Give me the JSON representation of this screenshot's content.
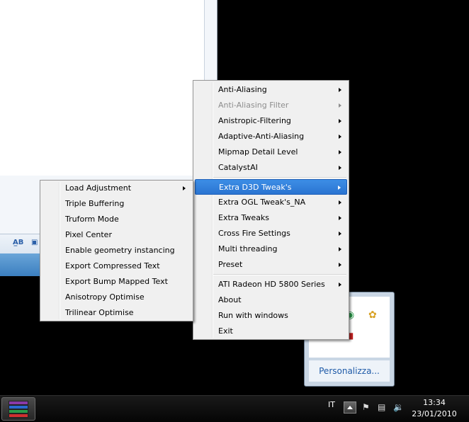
{
  "main_menu": {
    "items": [
      {
        "label": "Anti-Aliasing",
        "submenu": true,
        "disabled": false
      },
      {
        "label": "Anti-Aliasing Filter",
        "submenu": true,
        "disabled": true
      },
      {
        "label": "Anistropic-Filtering",
        "submenu": true,
        "disabled": false
      },
      {
        "label": "Adaptive-Anti-Aliasing",
        "submenu": true,
        "disabled": false
      },
      {
        "label": "Mipmap Detail Level",
        "submenu": true,
        "disabled": false
      },
      {
        "label": "CatalystAI",
        "submenu": true,
        "disabled": false
      },
      {
        "label": "Extra D3D Tweak's",
        "submenu": true,
        "selected": true
      },
      {
        "label": "Extra OGL Tweak's_NA",
        "submenu": true
      },
      {
        "label": "Extra Tweaks",
        "submenu": true
      },
      {
        "label": "Cross Fire Settings",
        "submenu": true
      },
      {
        "label": "Multi threading",
        "submenu": true
      },
      {
        "label": "Preset",
        "submenu": true
      },
      {
        "label": "ATI Radeon HD 5800 Series",
        "submenu": true
      },
      {
        "label": "About",
        "submenu": false
      },
      {
        "label": "Run with windows",
        "submenu": false
      },
      {
        "label": "Exit",
        "submenu": false
      }
    ]
  },
  "sub_menu": {
    "items": [
      {
        "label": "Load Adjustment",
        "submenu": true
      },
      {
        "label": "Triple Buffering",
        "submenu": false
      },
      {
        "label": "Truform Mode",
        "submenu": false
      },
      {
        "label": "Pixel Center",
        "submenu": false
      },
      {
        "label": "Enable geometry instancing",
        "submenu": false
      },
      {
        "label": "Export Compressed Text",
        "submenu": false
      },
      {
        "label": "Export Bump Mapped Text",
        "submenu": false
      },
      {
        "label": "Anisotropy Optimise",
        "submenu": false
      },
      {
        "label": "Trilinear Optimise",
        "submenu": false
      }
    ]
  },
  "tray_popup": {
    "customize_link": "Personalizza..."
  },
  "taskbar": {
    "language": "IT",
    "time": "13:34",
    "date": "23/01/2010",
    "pinned_app_icon": "winrar-icon"
  },
  "colors": {
    "menu_background": "#f0f0f0",
    "selection": "#2a74d1",
    "taskbar": "#0a0a0a"
  }
}
